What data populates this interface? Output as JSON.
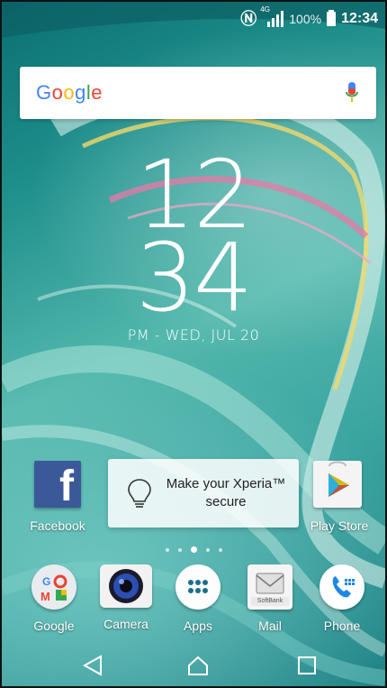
{
  "status_bar": {
    "network_type": "4G",
    "battery_percent": "100%",
    "time": "12:34"
  },
  "search": {
    "logo_text": "Google"
  },
  "clock": {
    "hours": "12",
    "minutes": "34",
    "date_line": "PM - WED, JUL 20"
  },
  "home_apps": {
    "facebook_label": "Facebook",
    "play_store_label": "Play Store"
  },
  "widget": {
    "line1": "Make your Xperia™",
    "line2": "secure"
  },
  "page_indicator": {
    "count": 5,
    "active_index": 2
  },
  "dock": {
    "items": [
      {
        "label": "Google"
      },
      {
        "label": "Camera"
      },
      {
        "label": "Apps"
      },
      {
        "label": "Mail"
      },
      {
        "label": "Phone"
      }
    ],
    "mail_badge_text": "SoftBank"
  },
  "colors": {
    "facebook_blue": "#3b5998",
    "phone_blue": "#1e88e5",
    "wallpaper_teal": "#2a9a95"
  }
}
